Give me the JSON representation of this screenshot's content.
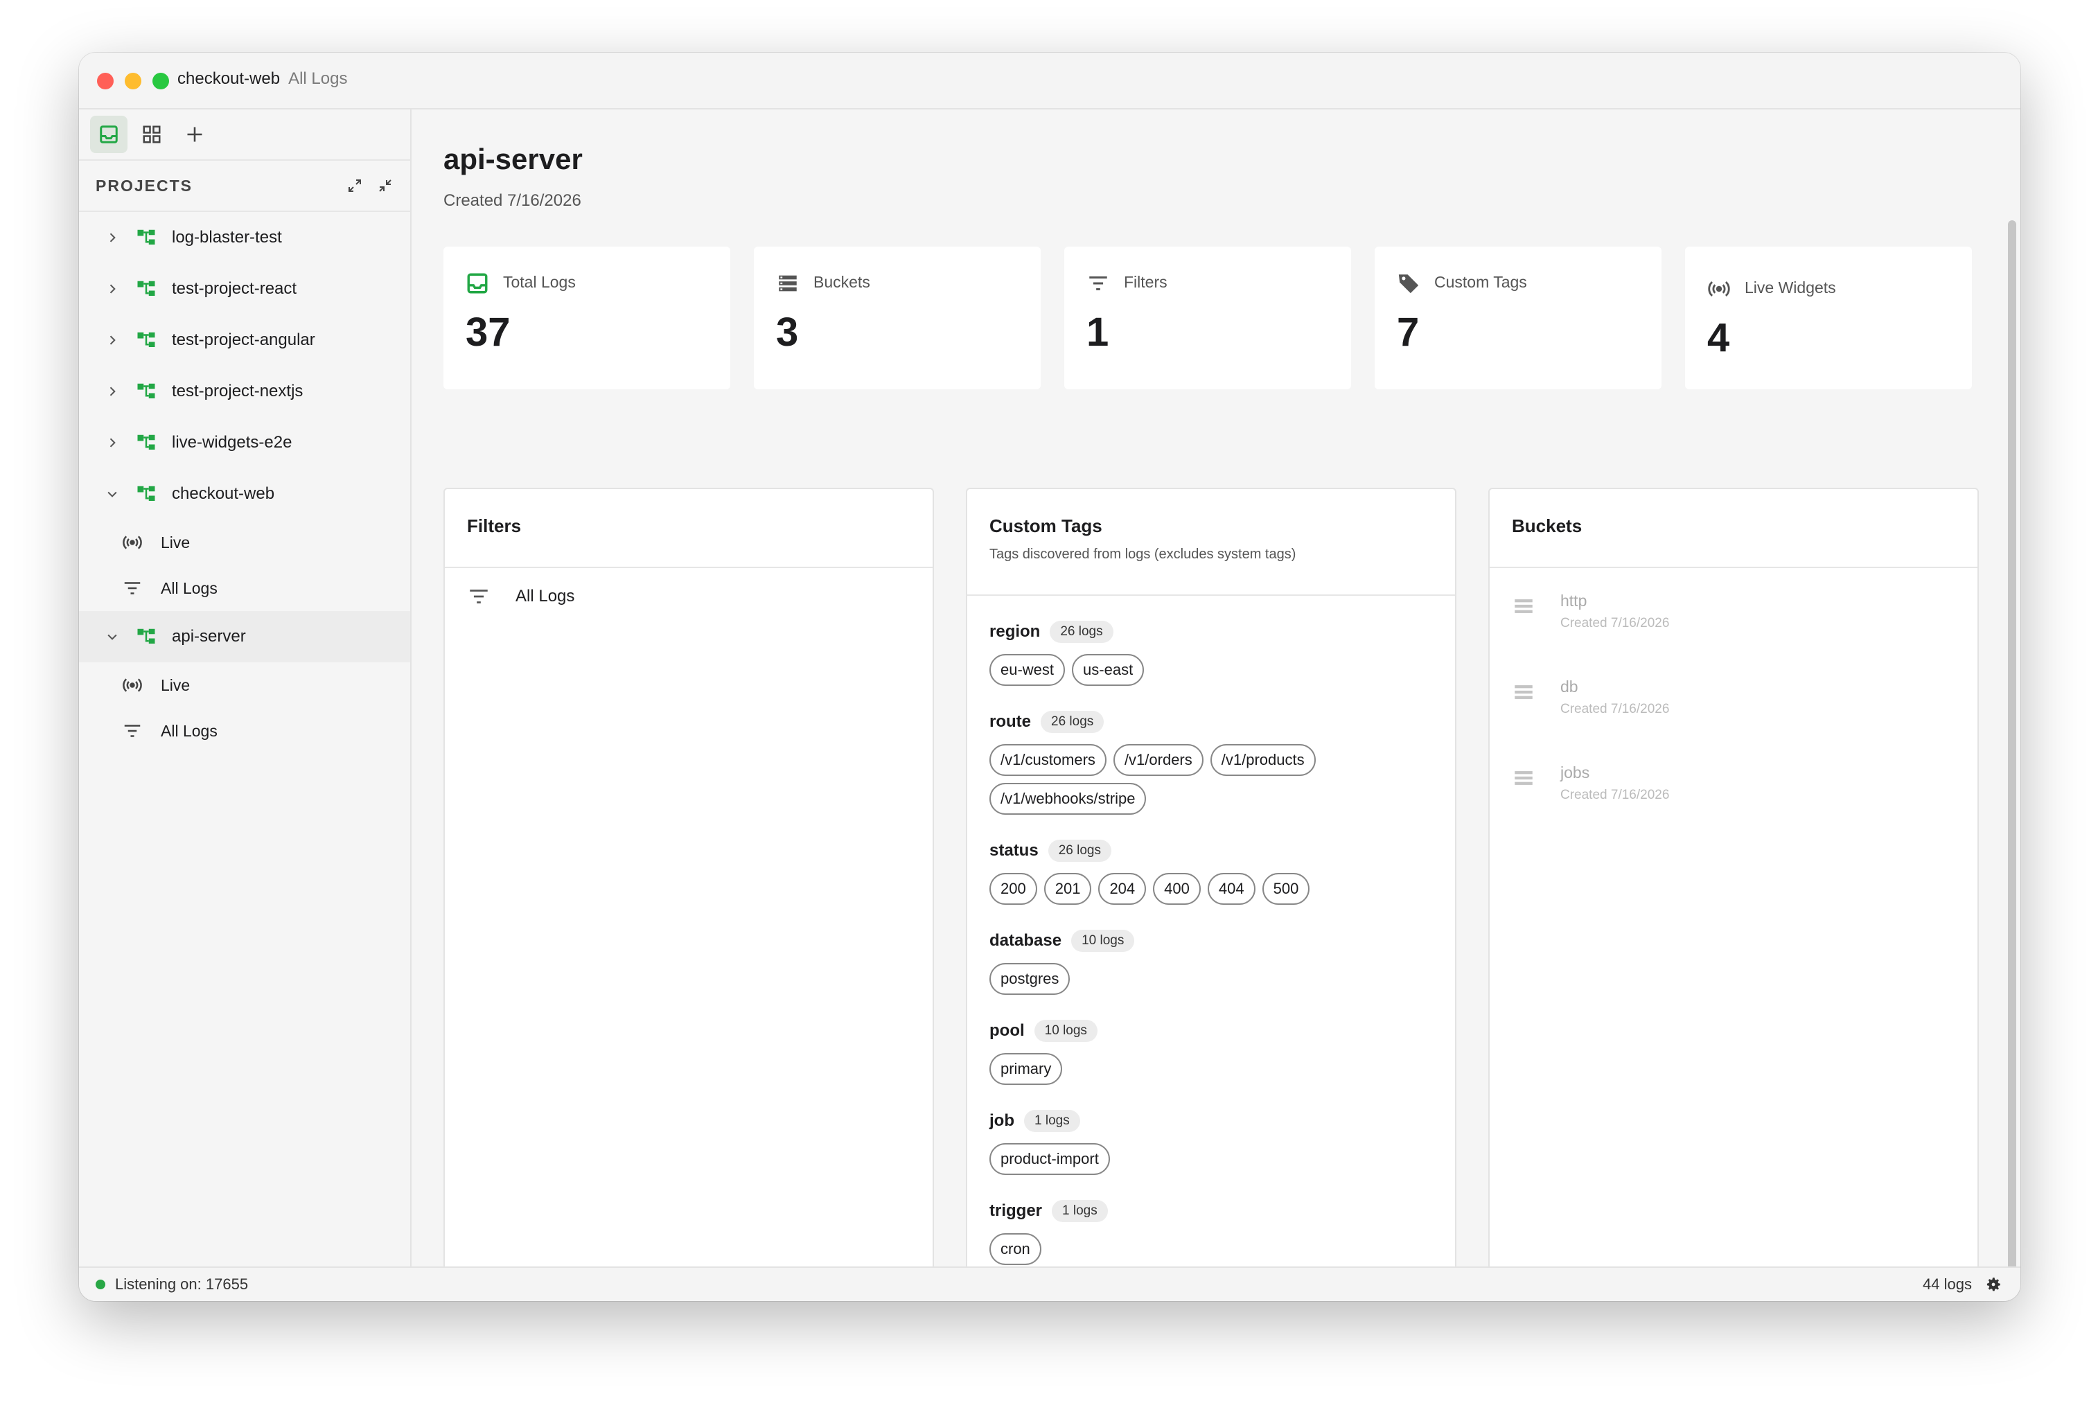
{
  "window": {
    "project": "checkout-web",
    "view": "All Logs"
  },
  "colors": {
    "accent": "#22a745",
    "traffic_red": "#ff5f57",
    "traffic_yellow": "#febc2e",
    "traffic_green": "#28c840"
  },
  "sidebar": {
    "tab_icons": [
      "inbox-icon",
      "grid-icon",
      "plus-icon"
    ],
    "header": "PROJECTS",
    "projects": [
      {
        "label": "log-blaster-test",
        "expanded": false
      },
      {
        "label": "test-project-react",
        "expanded": false
      },
      {
        "label": "test-project-angular",
        "expanded": false
      },
      {
        "label": "test-project-nextjs",
        "expanded": false
      },
      {
        "label": "live-widgets-e2e",
        "expanded": false
      },
      {
        "label": "checkout-web",
        "expanded": true,
        "children": [
          {
            "label": "Live"
          },
          {
            "label": "All Logs"
          }
        ]
      },
      {
        "label": "api-server",
        "expanded": true,
        "selected": true,
        "children": [
          {
            "label": "Live"
          },
          {
            "label": "All Logs"
          }
        ]
      }
    ]
  },
  "main": {
    "title": "api-server",
    "created": "Created 7/16/2026",
    "stats": [
      {
        "label": "Total Logs",
        "value": "37",
        "icon": "inbox-icon"
      },
      {
        "label": "Buckets",
        "value": "3",
        "icon": "buckets-icon"
      },
      {
        "label": "Filters",
        "value": "1",
        "icon": "filter-icon"
      },
      {
        "label": "Custom Tags",
        "value": "7",
        "icon": "tag-icon"
      },
      {
        "label": "Live Widgets",
        "value": "4",
        "icon": "broadcast-icon"
      }
    ],
    "filters": {
      "title": "Filters",
      "items": [
        {
          "label": "All Logs"
        }
      ]
    },
    "custom_tags": {
      "title": "Custom Tags",
      "subtitle": "Tags discovered from logs (excludes system tags)",
      "groups": [
        {
          "key": "region",
          "count": "26 logs",
          "values": [
            "eu-west",
            "us-east"
          ]
        },
        {
          "key": "route",
          "count": "26 logs",
          "values": [
            "/v1/customers",
            "/v1/orders",
            "/v1/products",
            "/v1/webhooks/stripe"
          ]
        },
        {
          "key": "status",
          "count": "26 logs",
          "values": [
            "200",
            "201",
            "204",
            "400",
            "404",
            "500"
          ]
        },
        {
          "key": "database",
          "count": "10 logs",
          "values": [
            "postgres"
          ]
        },
        {
          "key": "pool",
          "count": "10 logs",
          "values": [
            "primary"
          ]
        },
        {
          "key": "job",
          "count": "1 logs",
          "values": [
            "product-import"
          ]
        },
        {
          "key": "trigger",
          "count": "1 logs",
          "values": [
            "cron"
          ]
        }
      ]
    },
    "buckets": {
      "title": "Buckets",
      "items": [
        {
          "name": "http",
          "created": "Created 7/16/2026"
        },
        {
          "name": "db",
          "created": "Created 7/16/2026"
        },
        {
          "name": "jobs",
          "created": "Created 7/16/2026"
        }
      ]
    }
  },
  "statusbar": {
    "listening": "Listening on: 17655",
    "log_count": "44 logs"
  }
}
